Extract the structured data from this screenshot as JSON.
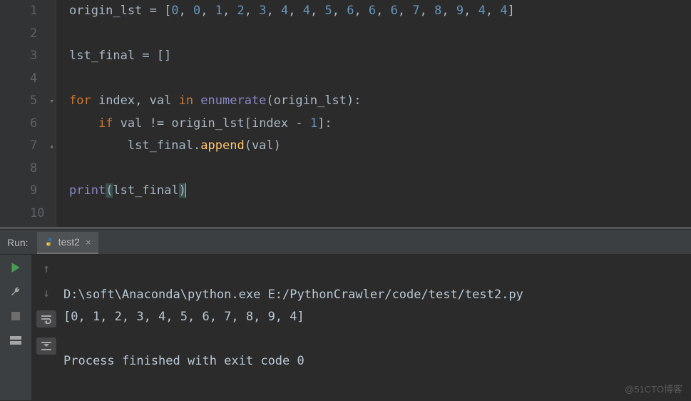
{
  "editor": {
    "lines": [
      "1",
      "2",
      "3",
      "4",
      "5",
      "6",
      "7",
      "8",
      "9",
      "10"
    ],
    "code": {
      "l1": {
        "var": "origin_lst",
        "eq": " = [",
        "vals": [
          "0",
          "0",
          "1",
          "2",
          "3",
          "4",
          "4",
          "5",
          "6",
          "6",
          "6",
          "7",
          "8",
          "9",
          "4",
          "4"
        ],
        "close": "]"
      },
      "l3": {
        "text": "lst_final = []"
      },
      "l5": {
        "for": "for ",
        "idx": "index",
        "comma": ", ",
        "val": "val",
        "in": " in ",
        "enum": "enumerate",
        "open": "(",
        "arg": "origin_lst",
        "close": "):"
      },
      "l6": {
        "indent": "    ",
        "if": "if ",
        "val": "val",
        "neq": " != ",
        "arr": "origin_lst",
        "br": "[",
        "idx": "index",
        "minus": " - ",
        "one": "1",
        "brc": "]:"
      },
      "l7": {
        "indent": "        ",
        "obj": "lst_final",
        "dot": ".",
        "fn": "append",
        "open": "(",
        "arg": "val",
        "close": ")"
      },
      "l9": {
        "print": "print",
        "open": "(",
        "arg": "lst_final",
        "close": ")"
      }
    }
  },
  "run": {
    "label": "Run:",
    "tab": "test2"
  },
  "console": {
    "line1": "D:\\soft\\Anaconda\\python.exe E:/PythonCrawler/code/test/test2.py",
    "line2": "[0, 1, 2, 3, 4, 5, 6, 7, 8, 9, 4]",
    "line3": "",
    "line4": "Process finished with exit code 0"
  },
  "watermark": "@51CTO博客"
}
